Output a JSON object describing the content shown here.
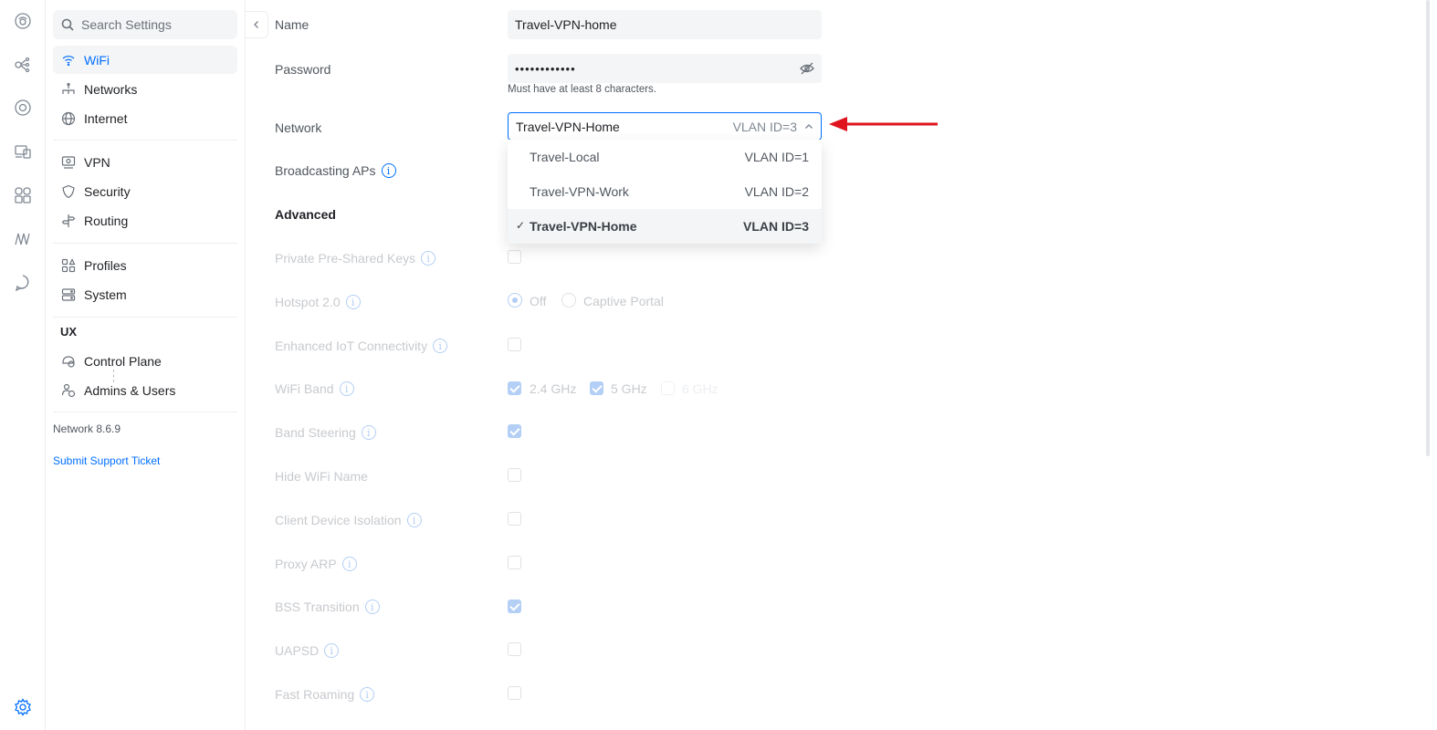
{
  "sidebar": {
    "search_placeholder": "Search Settings",
    "items": [
      {
        "label": "WiFi",
        "icon": "wifi-icon"
      },
      {
        "label": "Networks",
        "icon": "networks-icon"
      },
      {
        "label": "Internet",
        "icon": "globe-icon"
      },
      {
        "label": "VPN",
        "icon": "vpn-icon"
      },
      {
        "label": "Security",
        "icon": "shield-icon"
      },
      {
        "label": "Routing",
        "icon": "routing-icon"
      },
      {
        "label": "Profiles",
        "icon": "profiles-icon"
      },
      {
        "label": "System",
        "icon": "system-icon"
      }
    ],
    "ux_heading": "UX",
    "ux_items": [
      {
        "label": "Control Plane",
        "icon": "control-plane-icon"
      },
      {
        "label": "Admins & Users",
        "icon": "admins-icon"
      }
    ],
    "version": "Network 8.6.9",
    "support_link": "Submit Support Ticket"
  },
  "rail_icons": [
    "dashboard-icon",
    "topology-icon",
    "unifi-devices-icon",
    "client-devices-icon",
    "ports-icon",
    "insights-icon",
    "alerts-icon",
    "settings-icon"
  ],
  "form": {
    "name_label": "Name",
    "name_value": "Travel-VPN-home",
    "password_label": "Password",
    "password_value": "••••••••••••",
    "password_hint": "Must have at least 8 characters.",
    "network_label": "Network",
    "network_value": "Travel-VPN-Home",
    "network_vlan": "VLAN ID=3",
    "broadcasting_label": "Broadcasting APs",
    "advanced_label": "Advanced",
    "private_psk_label": "Private Pre-Shared Keys",
    "hotspot_label": "Hotspot 2.0",
    "hotspot_off": "Off",
    "hotspot_portal": "Captive Portal",
    "iot_label": "Enhanced IoT Connectivity",
    "band_label": "WiFi Band",
    "band_24": "2.4 GHz",
    "band_5": "5 GHz",
    "band_6": "6 GHz",
    "steering_label": "Band Steering",
    "hide_label": "Hide WiFi Name",
    "isolation_label": "Client Device Isolation",
    "proxy_label": "Proxy ARP",
    "bss_label": "BSS Transition",
    "uapsd_label": "UAPSD",
    "roaming_label": "Fast Roaming"
  },
  "dropdown": {
    "options": [
      {
        "name": "Travel-Local",
        "vlan": "VLAN ID=1",
        "selected": false
      },
      {
        "name": "Travel-VPN-Work",
        "vlan": "VLAN ID=2",
        "selected": false
      },
      {
        "name": "Travel-VPN-Home",
        "vlan": "VLAN ID=3",
        "selected": true
      }
    ],
    "check_mark": "✓"
  },
  "colors": {
    "accent": "#006fff",
    "annotation_arrow": "#e0141e"
  }
}
